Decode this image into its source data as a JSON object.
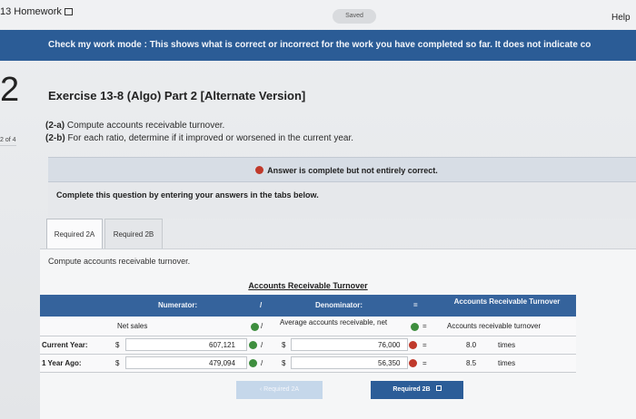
{
  "header": {
    "title": "13 Homework",
    "saved": "Saved",
    "help": "Help"
  },
  "banner": {
    "text": "Check my work mode : This shows what is correct or incorrect for the work you have completed so far. It does not indicate co"
  },
  "question": {
    "number": "2",
    "count": "2 of 4"
  },
  "exercise": {
    "title": "Exercise 13-8 (Algo) Part 2 [Alternate Version]",
    "part_a_tag": "(2-a)",
    "part_a_text": "Compute accounts receivable turnover.",
    "part_b_tag": "(2-b)",
    "part_b_text": "For each ratio, determine if it improved or worsened in the current year."
  },
  "status": {
    "text": "Answer is complete but not entirely correct."
  },
  "instructions": "Complete this question by entering your answers in the tabs below.",
  "tabs": [
    {
      "label": "Required 2A"
    },
    {
      "label": "Required 2B"
    }
  ],
  "panel": {
    "caption": "Compute accounts receivable turnover."
  },
  "table": {
    "title": "Accounts Receivable Turnover",
    "head": {
      "numerator": "Numerator:",
      "div": "/",
      "denominator": "Denominator:",
      "eq": "=",
      "result": "Accounts Receivable Turnover"
    },
    "labels": {
      "numerator": "Net sales",
      "div": "/",
      "denominator": "Average accounts receivable, net",
      "eq": "=",
      "result": "Accounts receivable turnover"
    },
    "rows": [
      {
        "label": "Current Year:",
        "cur1": "$",
        "numerator": "607,121",
        "div": "/",
        "cur2": "$",
        "denominator": "76,000",
        "eq": "=",
        "result": "8.0",
        "unit": "times"
      },
      {
        "label": "1 Year Ago:",
        "cur1": "$",
        "numerator": "479,094",
        "div": "/",
        "cur2": "$",
        "denominator": "56,350",
        "eq": "=",
        "result": "8.5",
        "unit": "times"
      }
    ]
  },
  "nav": {
    "prev": "Required 2A",
    "next": "Required 2B"
  },
  "colors": {
    "banner": "#2b5c96",
    "table_header": "#35639c",
    "correct": "#3e8e3e",
    "incorrect": "#c0392b"
  }
}
